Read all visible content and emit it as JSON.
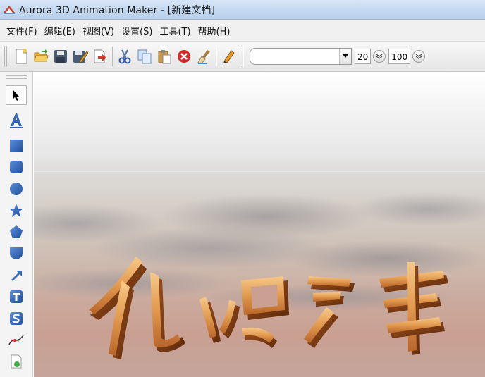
{
  "window": {
    "title": "Aurora 3D Animation Maker - [新建文档]"
  },
  "menu": {
    "items": [
      {
        "label": "文件(F)"
      },
      {
        "label": "编辑(E)"
      },
      {
        "label": "视图(V)"
      },
      {
        "label": "设置(S)"
      },
      {
        "label": "工具(T)"
      },
      {
        "label": "帮助(H)"
      }
    ]
  },
  "toolbar": {
    "buttons": [
      "new-doc-icon",
      "open-folder-icon",
      "save-icon",
      "save-as-icon",
      "export-icon",
      "cut-icon",
      "copy-icon",
      "paste-icon",
      "delete-icon",
      "clear-icon",
      "edit-pencil-icon"
    ],
    "font_value": "",
    "font_size": "20",
    "scale_value": "100"
  },
  "tools": [
    "select-arrow-icon",
    "text-a-icon",
    "square-icon",
    "rounded-square-icon",
    "circle-icon",
    "star-icon",
    "pentagon-icon",
    "shield-icon",
    "arrow-icon",
    "t-box-icon",
    "s-box-icon",
    "curve-icon",
    "image-icon"
  ],
  "colors": {
    "title_bar": "#c3d8f0",
    "text_gold": "#d98a3d",
    "text_shadow": "#7a3f16"
  }
}
